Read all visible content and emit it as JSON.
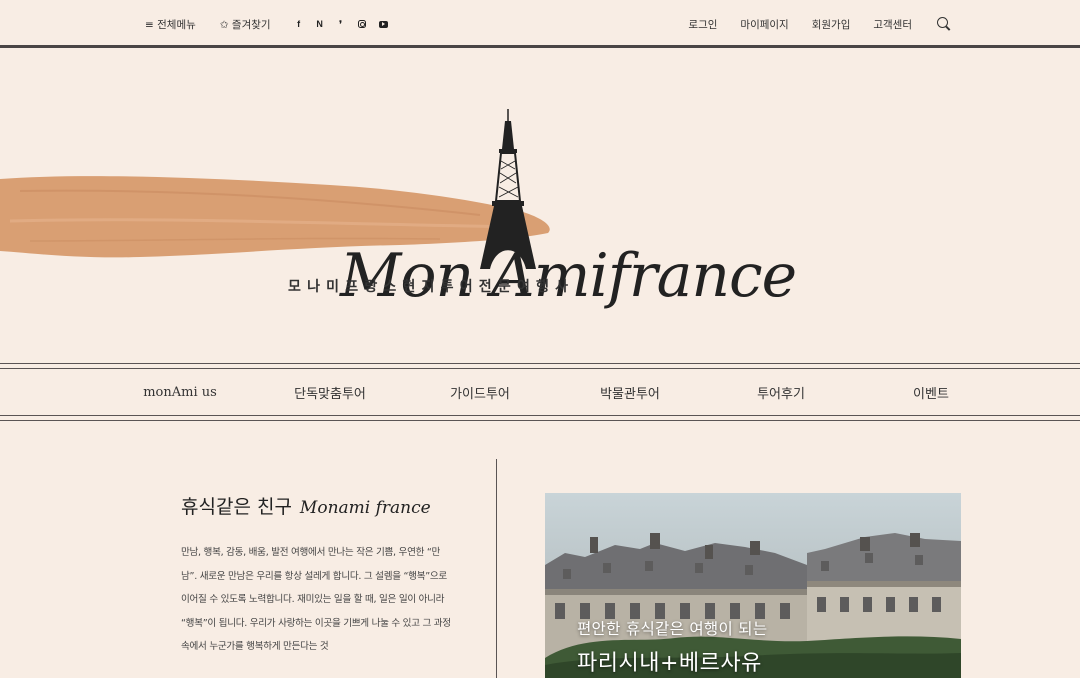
{
  "topbar": {
    "menu_label": "≡ 전체메뉴",
    "favorite_label": "✩ 즐겨찾기",
    "social": [
      "f",
      "N",
      "❜"
    ],
    "login": "로그인",
    "mypage": "마이페이지",
    "signup": "회원가입",
    "support": "고객센터"
  },
  "hero": {
    "logo_script": "Mon Amifrance",
    "logo_sub": "모나미프랑스현지투어전문여행사",
    "brush_color": "#d99f73"
  },
  "nav": {
    "items": [
      "monAmi us",
      "단독맞춤투어",
      "가이드투어",
      "박물관투어",
      "투어후기",
      "이벤트"
    ]
  },
  "intro": {
    "title_ko": "휴식같은 친구",
    "title_brand": "Monami france",
    "body": "만남, 행복, 감동, 배움, 발전 여행에서 만나는 작은 기쁨, 우연한 “만남”. 새로운 만남은 우리를 항상 설레게 합니다. 그 설렘을 “행복”으로 이어질 수 있도록 노력합니다. 재미있는 일을 할 때, 일은 일이 아니라 “행복”이 됩니다. 우리가 사랑하는 이곳을 기쁘게 나눌 수 있고 그 과정 속에서 누군가를 행복하게 만든다는 것"
  },
  "feature": {
    "caption_line1": "편안한 휴식같은 여행이 되는",
    "caption_line2": "파리시내+베르사유"
  },
  "colors": {
    "background": "#f8ede4",
    "lines": "#4a4545"
  }
}
